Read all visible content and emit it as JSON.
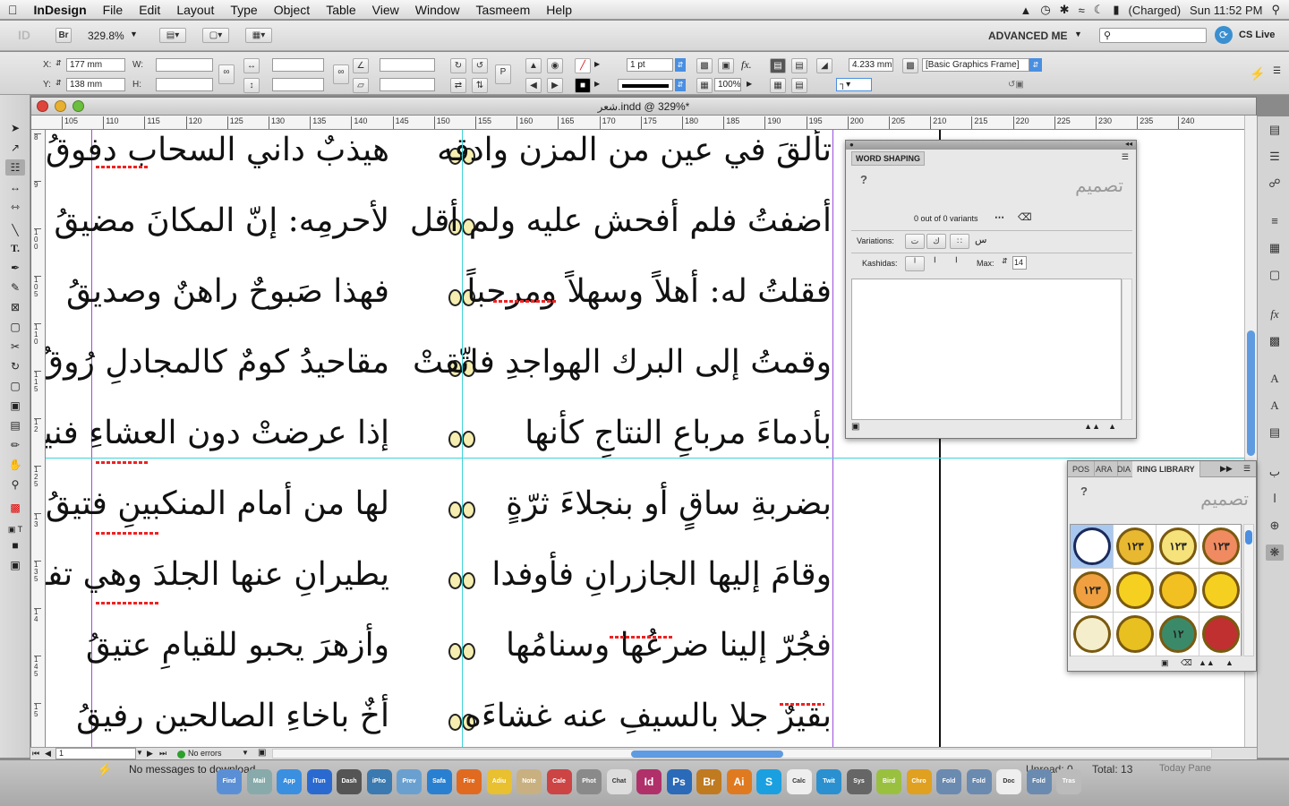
{
  "menubar": {
    "app_name": "InDesign",
    "items": [
      "File",
      "Edit",
      "Layout",
      "Type",
      "Object",
      "Table",
      "View",
      "Window",
      "Tasmeem",
      "Help"
    ],
    "battery": "(Charged)",
    "clock": "Sun 11:52 PM"
  },
  "appbar": {
    "id_logo": "ID",
    "bridge": "Br",
    "zoom": "329.8%",
    "workspace": "ADVANCED ME",
    "cs_live": "CS Live"
  },
  "control": {
    "x_label": "X:",
    "x_value": "177 mm",
    "y_label": "Y:",
    "y_value": "138 mm",
    "w_label": "W:",
    "h_label": "H:",
    "stroke_weight": "1 pt",
    "opacity": "100%",
    "dimension": "4.233 mm",
    "object_style": "[Basic Graphics Frame]"
  },
  "document": {
    "title": "شعر.indd @ 329%*",
    "h_ruler": [
      "105",
      "110",
      "115",
      "120",
      "125",
      "130",
      "135",
      "140",
      "145",
      "150",
      "155",
      "160",
      "165",
      "170",
      "175",
      "180",
      "185",
      "190",
      "195",
      "200",
      "205",
      "210",
      "215",
      "220",
      "225",
      "230",
      "235",
      "240"
    ],
    "v_ruler": [
      "8",
      "9",
      "1 0 0",
      "1 0 5",
      "1 1 0",
      "1 1 5",
      "1 2",
      "1 2 5",
      "1 3",
      "1 3 5",
      "1 4",
      "1 4 5",
      "1 5"
    ],
    "verses": [
      {
        "right": "هيذبٌ  داني السحاب دفوقُ",
        "left": "تألقَ في عين من المزن وادقه"
      },
      {
        "right": "لأحرمِه: إنّ المكانَ مضيقُ",
        "left": "أضفتُ فلم أفحش عليه ولم أقل"
      },
      {
        "right": "فهذا صَبوحٌ راهنٌ وصديقُ",
        "left": "فقلتُ له: أهلاً وسهلاً ومرحباً"
      },
      {
        "right": "مقاحيدُ كومٌ كالمجادلِ رُوقُ",
        "left": "وقمتُ إلى البرك الهواجدِ فاتّقتْ"
      },
      {
        "right": "إذا عرضتْ دون العشاءِ فنيقُ",
        "left": "بأدماءَ مرباعِ النتاجِ كأنها"
      },
      {
        "right": "لها من أمام المنكبينِ فتيقُ",
        "left": "بضربةِ ساقٍ أو بنجلاءَ ثرّةٍ"
      },
      {
        "right": "يطيرانِ عنها الجلدَ وهي تفوقُ",
        "left": "وقامَ إليها الجازرانِ فأوفدا"
      },
      {
        "right": "وأزهرَ يحبو للقيامِ عتيقُ",
        "left": "فجُرّ إلينا ضرعُها وسنامُها"
      },
      {
        "right": "أخٌ باخاءِ الصالحين رفيقُ",
        "left": "بقيرٌ جلا بالسيفِ عنه غشاءَه"
      }
    ]
  },
  "word_shaping": {
    "title": "WORD SHAPING",
    "help": "?",
    "variants_text": "0 out of 0 variants",
    "variations_label": "Variations:",
    "kashidas_label": "Kashidas:",
    "max_label": "Max:",
    "max_value": "14"
  },
  "ring_library": {
    "tabs": [
      "POS",
      "ARA",
      "DIA",
      "RING LIBRARY"
    ],
    "help": "?",
    "items": [
      "",
      "١٢٣",
      "١٢٣",
      "١٢٣",
      "١٢٣",
      "",
      "",
      "",
      "",
      "",
      "١٢",
      ""
    ],
    "colors": [
      "#ffffff",
      "#e8b830",
      "#f5e27a",
      "#f08a60",
      "#f0a040",
      "#f5d020",
      "#f2c020",
      "#f5d020",
      "#f5eecc",
      "#e8c020",
      "#3a8a6a",
      "#c03030"
    ]
  },
  "status": {
    "page": "1",
    "errors": "No errors"
  },
  "dock": {
    "message": "No messages to download",
    "unread": "Unread: 0",
    "total": "Total: 13",
    "today_pane": "Today Pane",
    "apps": [
      "Finder",
      "Mail",
      "App Store",
      "iTunes",
      "Dashboard",
      "iPhoto",
      "Preview",
      "Safari",
      "Firefox",
      "Adium",
      "Notes",
      "Calendar",
      "Photo",
      "Chat",
      "Id",
      "Ps",
      "Br",
      "Ai",
      "S",
      "Calc",
      "Twitter",
      "Sys",
      "Bird",
      "Chrome",
      "Folder",
      "Folder",
      "Doc",
      "Folder",
      "Trash"
    ]
  }
}
